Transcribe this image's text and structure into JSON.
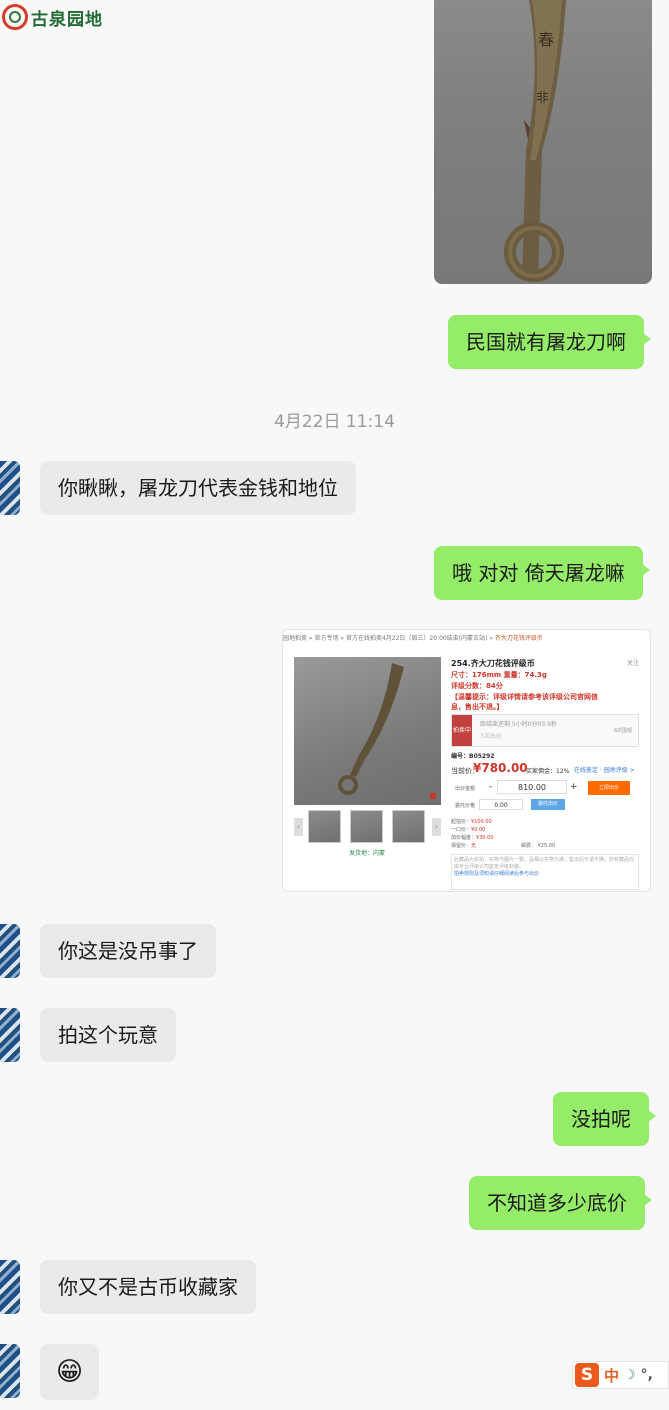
{
  "watermark": {
    "text": "古泉园地"
  },
  "conversation": {
    "timestamp": "4月22日 11:14",
    "messages": [
      {
        "sender": "me",
        "text": "民国就有屠龙刀啊"
      },
      {
        "sender": "contact",
        "text": "你瞅瞅，屠龙刀代表金钱和地位"
      },
      {
        "sender": "me",
        "text": "哦 对对 倚天屠龙嘛"
      },
      {
        "sender": "contact",
        "text": "你这是没吊事了"
      },
      {
        "sender": "contact",
        "text": "拍这个玩意"
      },
      {
        "sender": "me",
        "text": "没拍呢"
      },
      {
        "sender": "me",
        "text": "不知道多少底价"
      },
      {
        "sender": "contact",
        "text": "你又不是古币收藏家"
      },
      {
        "sender": "contact",
        "emoji": "😁"
      }
    ]
  },
  "auction_screenshot": {
    "breadcrumb": "园地拍卖 » 官方专场 » 官方在线拍卖4月22日（周三）20:00结束(内蒙古站) » ",
    "breadcrumb_item": "齐大刀花钱评级币",
    "title": "254.齐大刀花钱评级币",
    "favorite": "关注",
    "spec": "尺寸：176mm 重量：74.3g",
    "grade": "评级分数：84分",
    "notice": "【温馨提示：评级详情请参考该评级公司官网信息，售出不退。】",
    "status_badge": "拍卖中",
    "status_text": "距结束还剩 5小时0分03.9秒",
    "status_time": "3次出价",
    "status_right": "8次围观",
    "number": "编号：B05292",
    "price_label": "当前价：",
    "price": "¥780.00",
    "commission": "买家佣金：12%",
    "online_label": "在线鉴定 · 园地评级 >",
    "bid_label": "出价金额",
    "bid_minus": "-",
    "bid_value": "810.00",
    "bid_plus": "+",
    "bid_button": "立即出价",
    "deposit_label": "委托价格",
    "deposit_value": "0.00",
    "deposit_button": "委托出价",
    "info": [
      {
        "label": "起拍价：",
        "value": "¥100.00"
      },
      {
        "label": "一口价：",
        "value": "¥0.00"
      },
      {
        "label": "加价幅度：",
        "value": "¥30.00"
      },
      {
        "label": "保留价：",
        "value": "无"
      }
    ],
    "shipping": "邮费： ¥25.00",
    "seller": "发货地：内蒙",
    "description": "此藏品为实拍，实物与图片一致，品相以实物为准，售出后不退不换。所有藏品均由专业评级公司鉴定评级封装。",
    "description_link": "拍卖规则及须知请仔细阅读后参与出价"
  },
  "ime": {
    "logo": "S",
    "mode": "中",
    "moon": "☽",
    "punct": "°,"
  }
}
